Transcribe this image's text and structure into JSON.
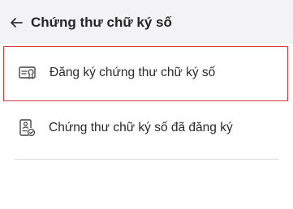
{
  "header": {
    "back_icon": "arrow-left-icon",
    "title": "Chứng thư chữ ký số"
  },
  "menu": {
    "items": [
      {
        "icon": "certificate-icon",
        "label": "Đăng ký chứng thư chữ ký số",
        "selected": true
      },
      {
        "icon": "registered-document-icon",
        "label": "Chứng thư chữ ký số đã đăng ký",
        "selected": false
      }
    ]
  },
  "colors": {
    "header_bg": "#f3f3f5",
    "selection_border": "#d33a3e",
    "text": "#262626",
    "divider": "#dcdcdc"
  }
}
